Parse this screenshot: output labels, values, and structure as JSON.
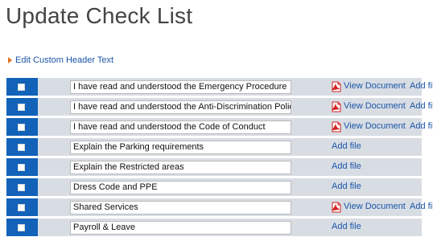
{
  "page": {
    "title": "Update Check List",
    "edit_header_link": "Edit Custom Header Text"
  },
  "colors": {
    "accent_blue": "#1162b8",
    "row_gray": "#d8dde4",
    "link_blue": "#1a55a8",
    "arrow_orange": "#e07020",
    "pdf_red": "#d42020"
  },
  "icons": {
    "document": "pdf-icon",
    "edit_link_marker": "orange-arrow-icon"
  },
  "checklist": {
    "view_document_label": "View Document",
    "add_file_label": "Add file",
    "items": [
      {
        "label": "I have read and understood the Emergency Procedure",
        "has_document": true,
        "checked": false
      },
      {
        "label": "I have read and understood the Anti-Discrimination Policy",
        "has_document": true,
        "checked": false
      },
      {
        "label": "I have read and understood the Code of Conduct",
        "has_document": true,
        "checked": false
      },
      {
        "label": "Explain the Parking requirements",
        "has_document": false,
        "checked": false
      },
      {
        "label": "Explain the Restricted areas",
        "has_document": false,
        "checked": false
      },
      {
        "label": "Dress Code and PPE",
        "has_document": false,
        "checked": false
      },
      {
        "label": "Shared Services",
        "has_document": true,
        "checked": false
      },
      {
        "label": "Payroll & Leave",
        "has_document": false,
        "checked": false
      }
    ]
  }
}
